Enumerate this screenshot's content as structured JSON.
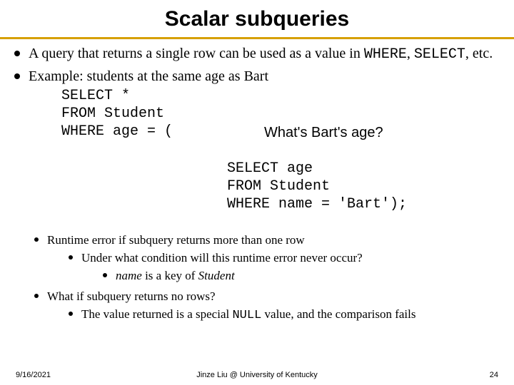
{
  "title": "Scalar subqueries",
  "bullets": {
    "b1_lead": "A query that returns a single row can be used as a value in ",
    "b1_code": "WHERE",
    "b1_mid": ", ",
    "b1_code2": "SELECT",
    "b1_tail": ", etc.",
    "b2": "Example: students at the same age as Bart"
  },
  "code_main": "SELECT *\nFROM Student\nWHERE age = (",
  "callout": "What's Bart's age?",
  "code_sub": "SELECT age\nFROM Student\nWHERE name = 'Bart');",
  "sub": {
    "s1": "Runtime error if subquery returns more than one row",
    "s1a": "Under what condition will this runtime error never occur?",
    "s1a_i_lead": "name",
    "s1a_i_mid": " is a key of ",
    "s1a_i_tail": "Student",
    "s2": "What if subquery returns no rows?",
    "s2a_lead": "The value returned is a special ",
    "s2a_code": "NULL",
    "s2a_tail": " value, and the comparison fails"
  },
  "footer": {
    "date": "9/16/2021",
    "mid": "Jinze Liu @ University of Kentucky",
    "num": "24"
  }
}
